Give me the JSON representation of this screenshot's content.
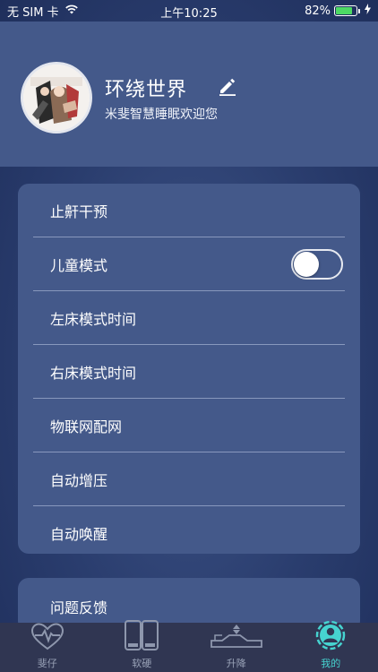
{
  "status_bar": {
    "carrier": "无 SIM 卡",
    "wifi_icon": "wifi-icon",
    "time": "上午10:25",
    "battery_percent": "82%",
    "battery_level": 0.82,
    "charging_icon": "bolt-icon"
  },
  "profile": {
    "username": "环绕世界",
    "welcome": "米斐智慧睡眠欢迎您",
    "avatar_icon": "avatar-image",
    "edit_icon": "pencil-icon"
  },
  "menu": {
    "items": [
      {
        "label": "止鼾干预"
      },
      {
        "label": "儿童模式",
        "toggle": false
      },
      {
        "label": "左床模式时间"
      },
      {
        "label": "右床模式时间"
      },
      {
        "label": "物联网配网"
      },
      {
        "label": "自动增压"
      },
      {
        "label": "自动唤醒"
      }
    ],
    "second": [
      {
        "label": "问题反馈"
      }
    ]
  },
  "tabbar": {
    "tabs": [
      {
        "label": "斐仔",
        "icon": "heart-pulse-icon",
        "active": false
      },
      {
        "label": "软硬",
        "icon": "bed-halves-icon",
        "active": false
      },
      {
        "label": "升降",
        "icon": "adjustable-bed-icon",
        "active": false
      },
      {
        "label": "我的",
        "icon": "user-icon",
        "active": true
      }
    ]
  },
  "colors": {
    "accent": "#46d3d0",
    "card": "#44598a",
    "tabbar": "#303652",
    "battery": "#4cd964"
  }
}
